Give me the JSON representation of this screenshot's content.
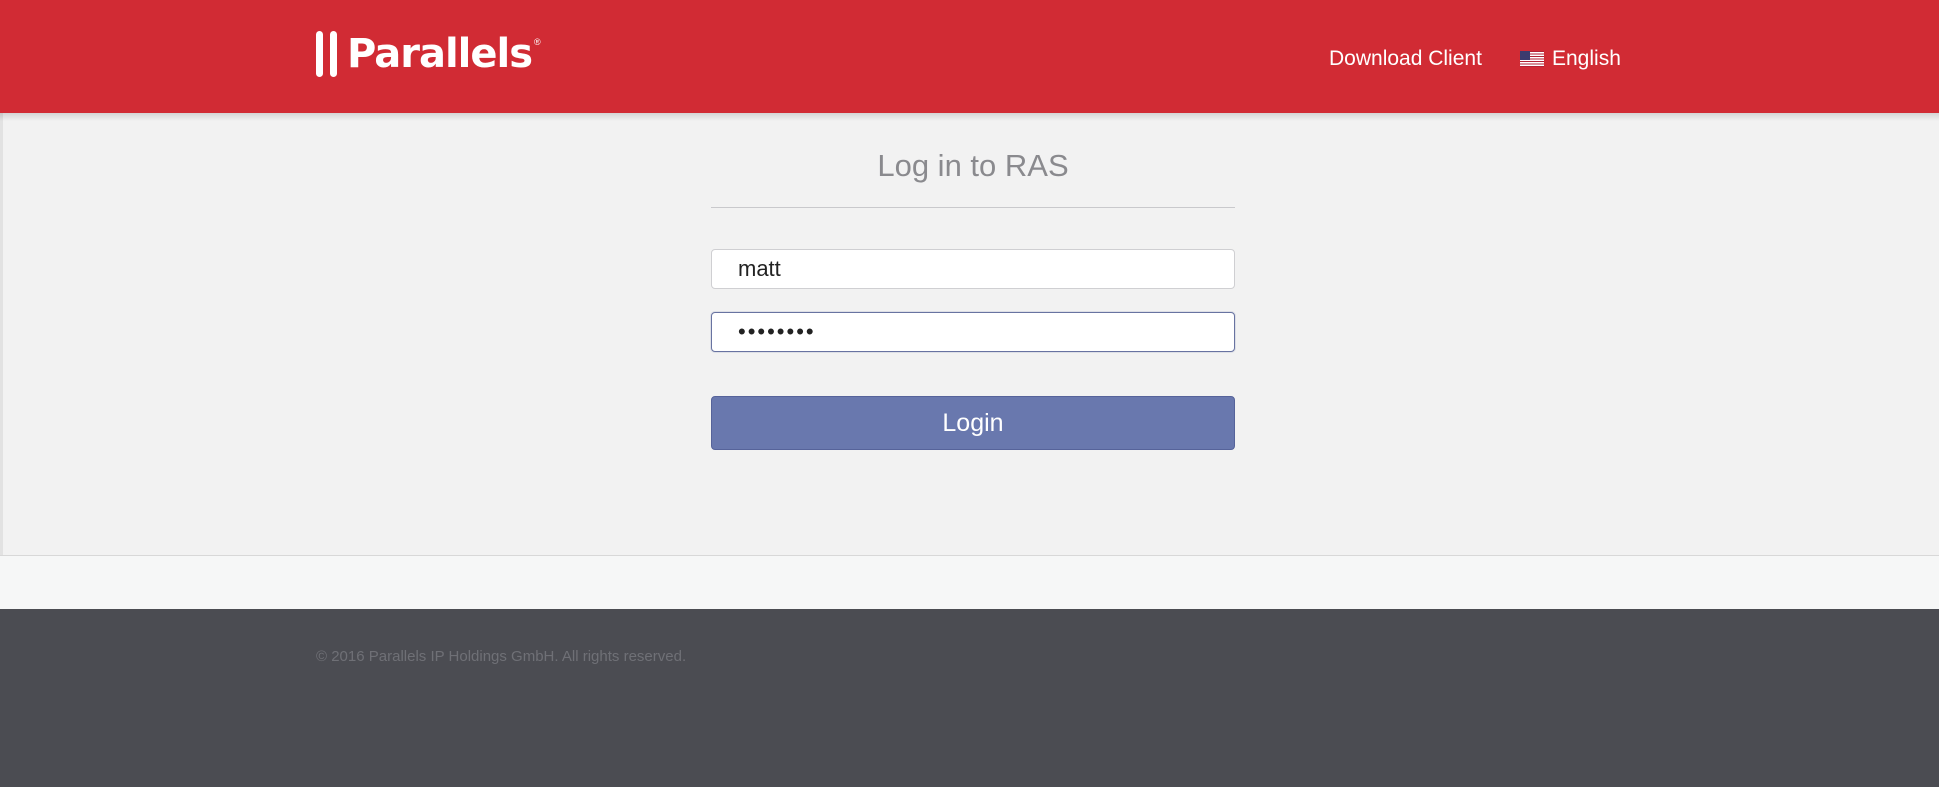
{
  "header": {
    "brand": "Parallels",
    "brand_mark": "®",
    "nav": {
      "download_client": "Download Client",
      "language": "English",
      "language_flag": "us-flag-icon"
    },
    "color": "#d12b34"
  },
  "login": {
    "title": "Log in to RAS",
    "username_value": "matt",
    "password_value": "password",
    "button_label": "Login",
    "button_color": "#6978ae"
  },
  "footer": {
    "copyright": "© 2016 Parallels IP Holdings GmbH. All rights reserved.",
    "color": "#4b4c52"
  }
}
